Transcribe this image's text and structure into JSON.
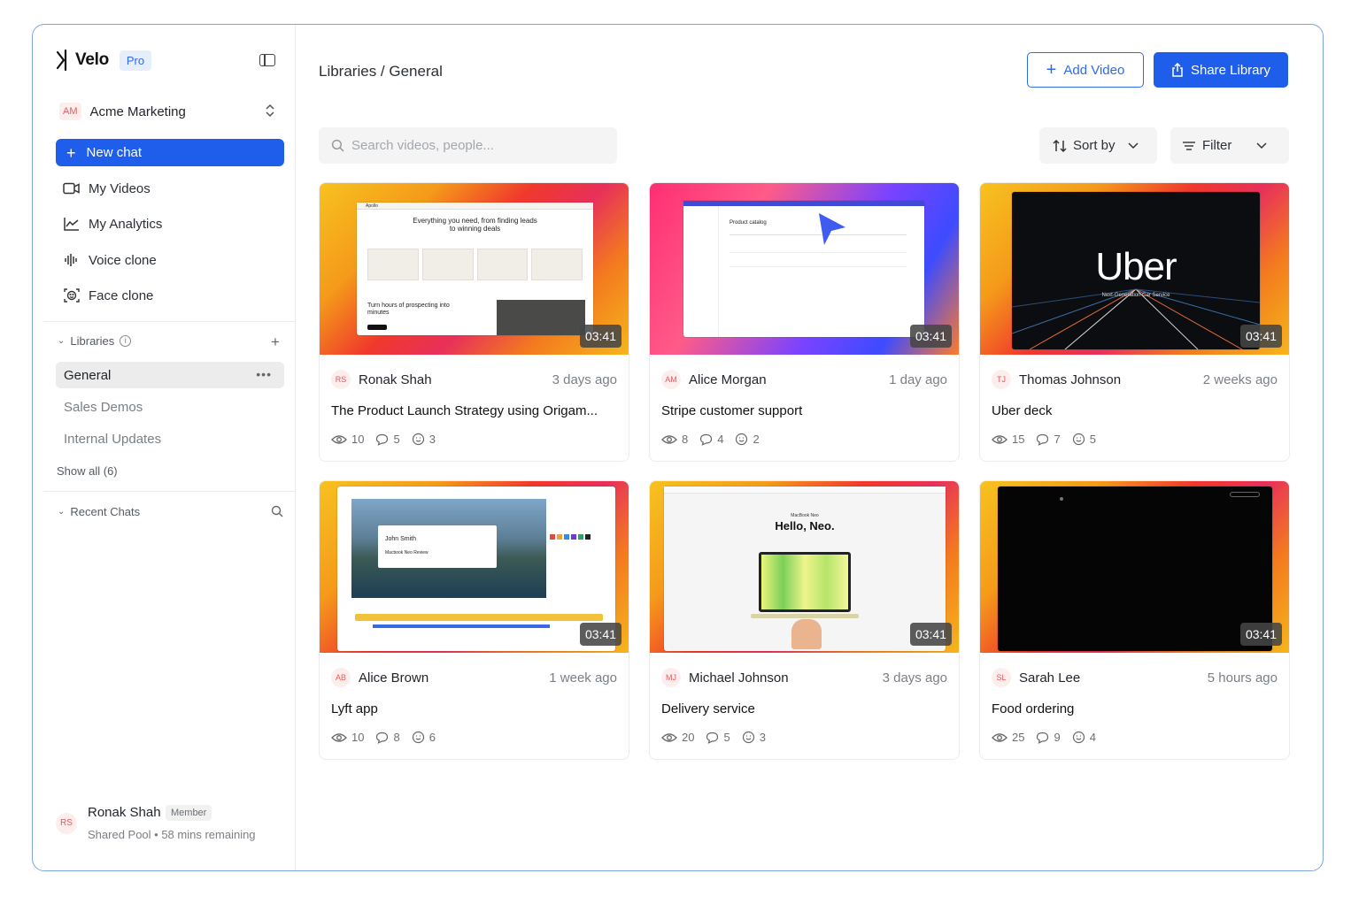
{
  "brand": {
    "name": "Velo",
    "plan": "Pro"
  },
  "workspace": {
    "initials": "AM",
    "name": "Acme Marketing"
  },
  "new_chat_label": "New chat",
  "nav": [
    {
      "label": "My Videos",
      "icon": "video-icon"
    },
    {
      "label": "My Analytics",
      "icon": "analytics-icon"
    },
    {
      "label": "Voice clone",
      "icon": "waveform-icon"
    },
    {
      "label": "Face clone",
      "icon": "face-scan-icon"
    }
  ],
  "libraries": {
    "heading": "Libraries",
    "items": [
      "General",
      "Sales Demos",
      "Internal Updates"
    ],
    "show_all": "Show all (6)"
  },
  "recent_chats": {
    "heading": "Recent Chats"
  },
  "user": {
    "initials": "RS",
    "name": "Ronak Shah",
    "role": "Member",
    "status": "Shared Pool • 58 mins remaining"
  },
  "header": {
    "breadcrumb": "Libraries / General",
    "add_video": "Add Video",
    "share_library": "Share Library"
  },
  "toolbar": {
    "search_placeholder": "Search videos, people...",
    "sort_label": "Sort by",
    "filter_label": "Filter"
  },
  "videos": [
    {
      "initials": "RS",
      "author": "Ronak Shah",
      "time": "3 days ago",
      "title": "The Product Launch Strategy using Origam...",
      "duration": "03:41",
      "views": "10",
      "comments": "5",
      "reactions": "3",
      "thumb_text": {
        "headline": "Everything you need, from finding leads to winning deals",
        "sub": "Turn hours of prospecting into minutes",
        "brand": "Apollo"
      }
    },
    {
      "initials": "AM",
      "author": "Alice Morgan",
      "time": "1 day ago",
      "title": "Stripe customer support",
      "duration": "03:41",
      "views": "8",
      "comments": "4",
      "reactions": "2",
      "thumb_text": {
        "heading": "Product catalog"
      }
    },
    {
      "initials": "TJ",
      "author": "Thomas Johnson",
      "time": "2 weeks ago",
      "title": "Uber deck",
      "duration": "03:41",
      "views": "15",
      "comments": "7",
      "reactions": "5",
      "thumb_text": {
        "logo": "Uber",
        "tagline": "Next-Generation Car Service"
      }
    },
    {
      "initials": "AB",
      "author": "Alice Brown",
      "time": "1 week ago",
      "title": "Lyft app",
      "duration": "03:41",
      "views": "10",
      "comments": "8",
      "reactions": "6",
      "thumb_text": {
        "name": "John Smith",
        "caption": "Macbook Neo Review"
      }
    },
    {
      "initials": "MJ",
      "author": "Michael Johnson",
      "time": "3 days ago",
      "title": "Delivery service",
      "duration": "03:41",
      "views": "20",
      "comments": "5",
      "reactions": "3",
      "thumb_text": {
        "kicker": "MacBook Neo",
        "headline": "Hello, Neo."
      }
    },
    {
      "initials": "SL",
      "author": "Sarah Lee",
      "time": "5 hours ago",
      "title": "Food ordering",
      "duration": "03:41",
      "views": "25",
      "comments": "9",
      "reactions": "4",
      "thumb_text": {}
    }
  ],
  "colors": {
    "accent": "#1f5eea",
    "badge_bg": "#fdeeee",
    "badge_text": "#e15a5a"
  }
}
